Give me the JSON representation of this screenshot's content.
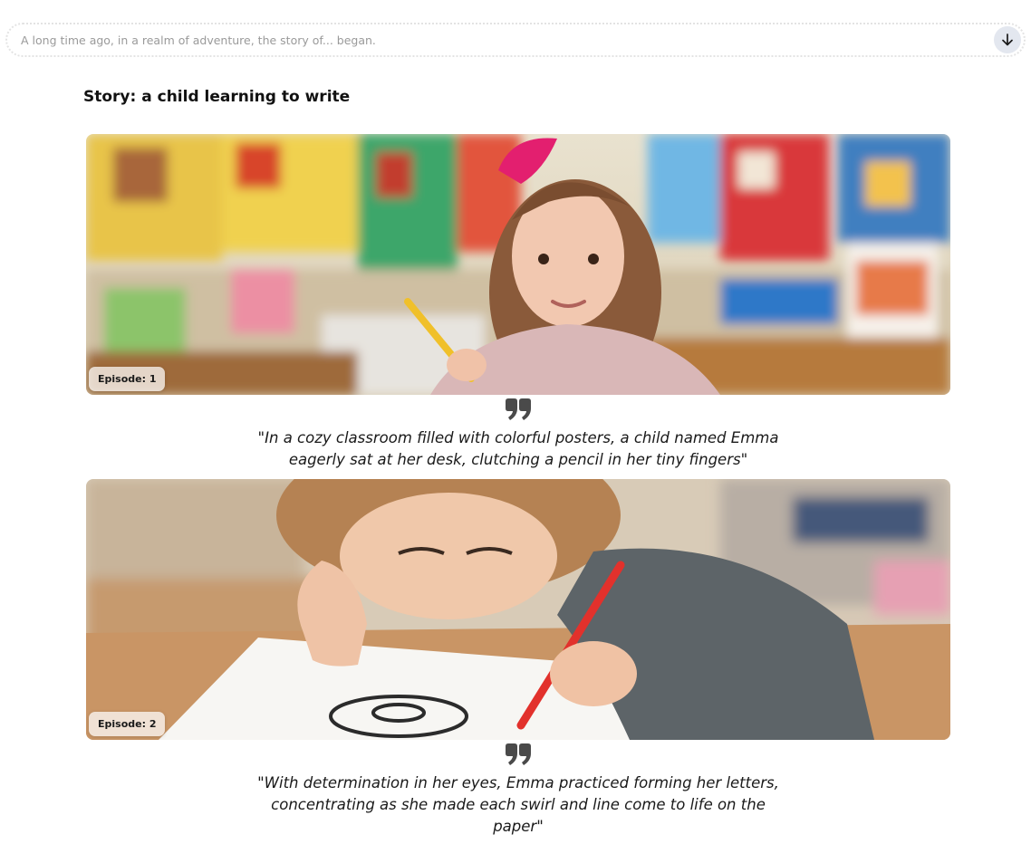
{
  "prompt": {
    "placeholder": "A long time ago, in a realm of adventure, the story of... began.",
    "submit_icon": "arrow-down-icon"
  },
  "story": {
    "title": "Story: a child learning to write"
  },
  "episodes": [
    {
      "badge": "Episode: 1",
      "image_alt": "girl with a pink bow holding a yellow pencil in a colorful classroom",
      "quote": "\"In a cozy classroom filled with colorful posters, a child named Emma eagerly sat at her desk, clutching a pencil in her tiny fingers\""
    },
    {
      "badge": "Episode: 2",
      "image_alt": "girl drawing a spiral on paper with a red pencil",
      "quote": "\"With determination in her eyes, Emma practiced forming her letters, concentrating as she made each swirl and line come to life on the paper\""
    }
  ],
  "colors": {
    "quote_icon": "#4a4a4a",
    "submit_button_bg": "#e3e7ef"
  }
}
